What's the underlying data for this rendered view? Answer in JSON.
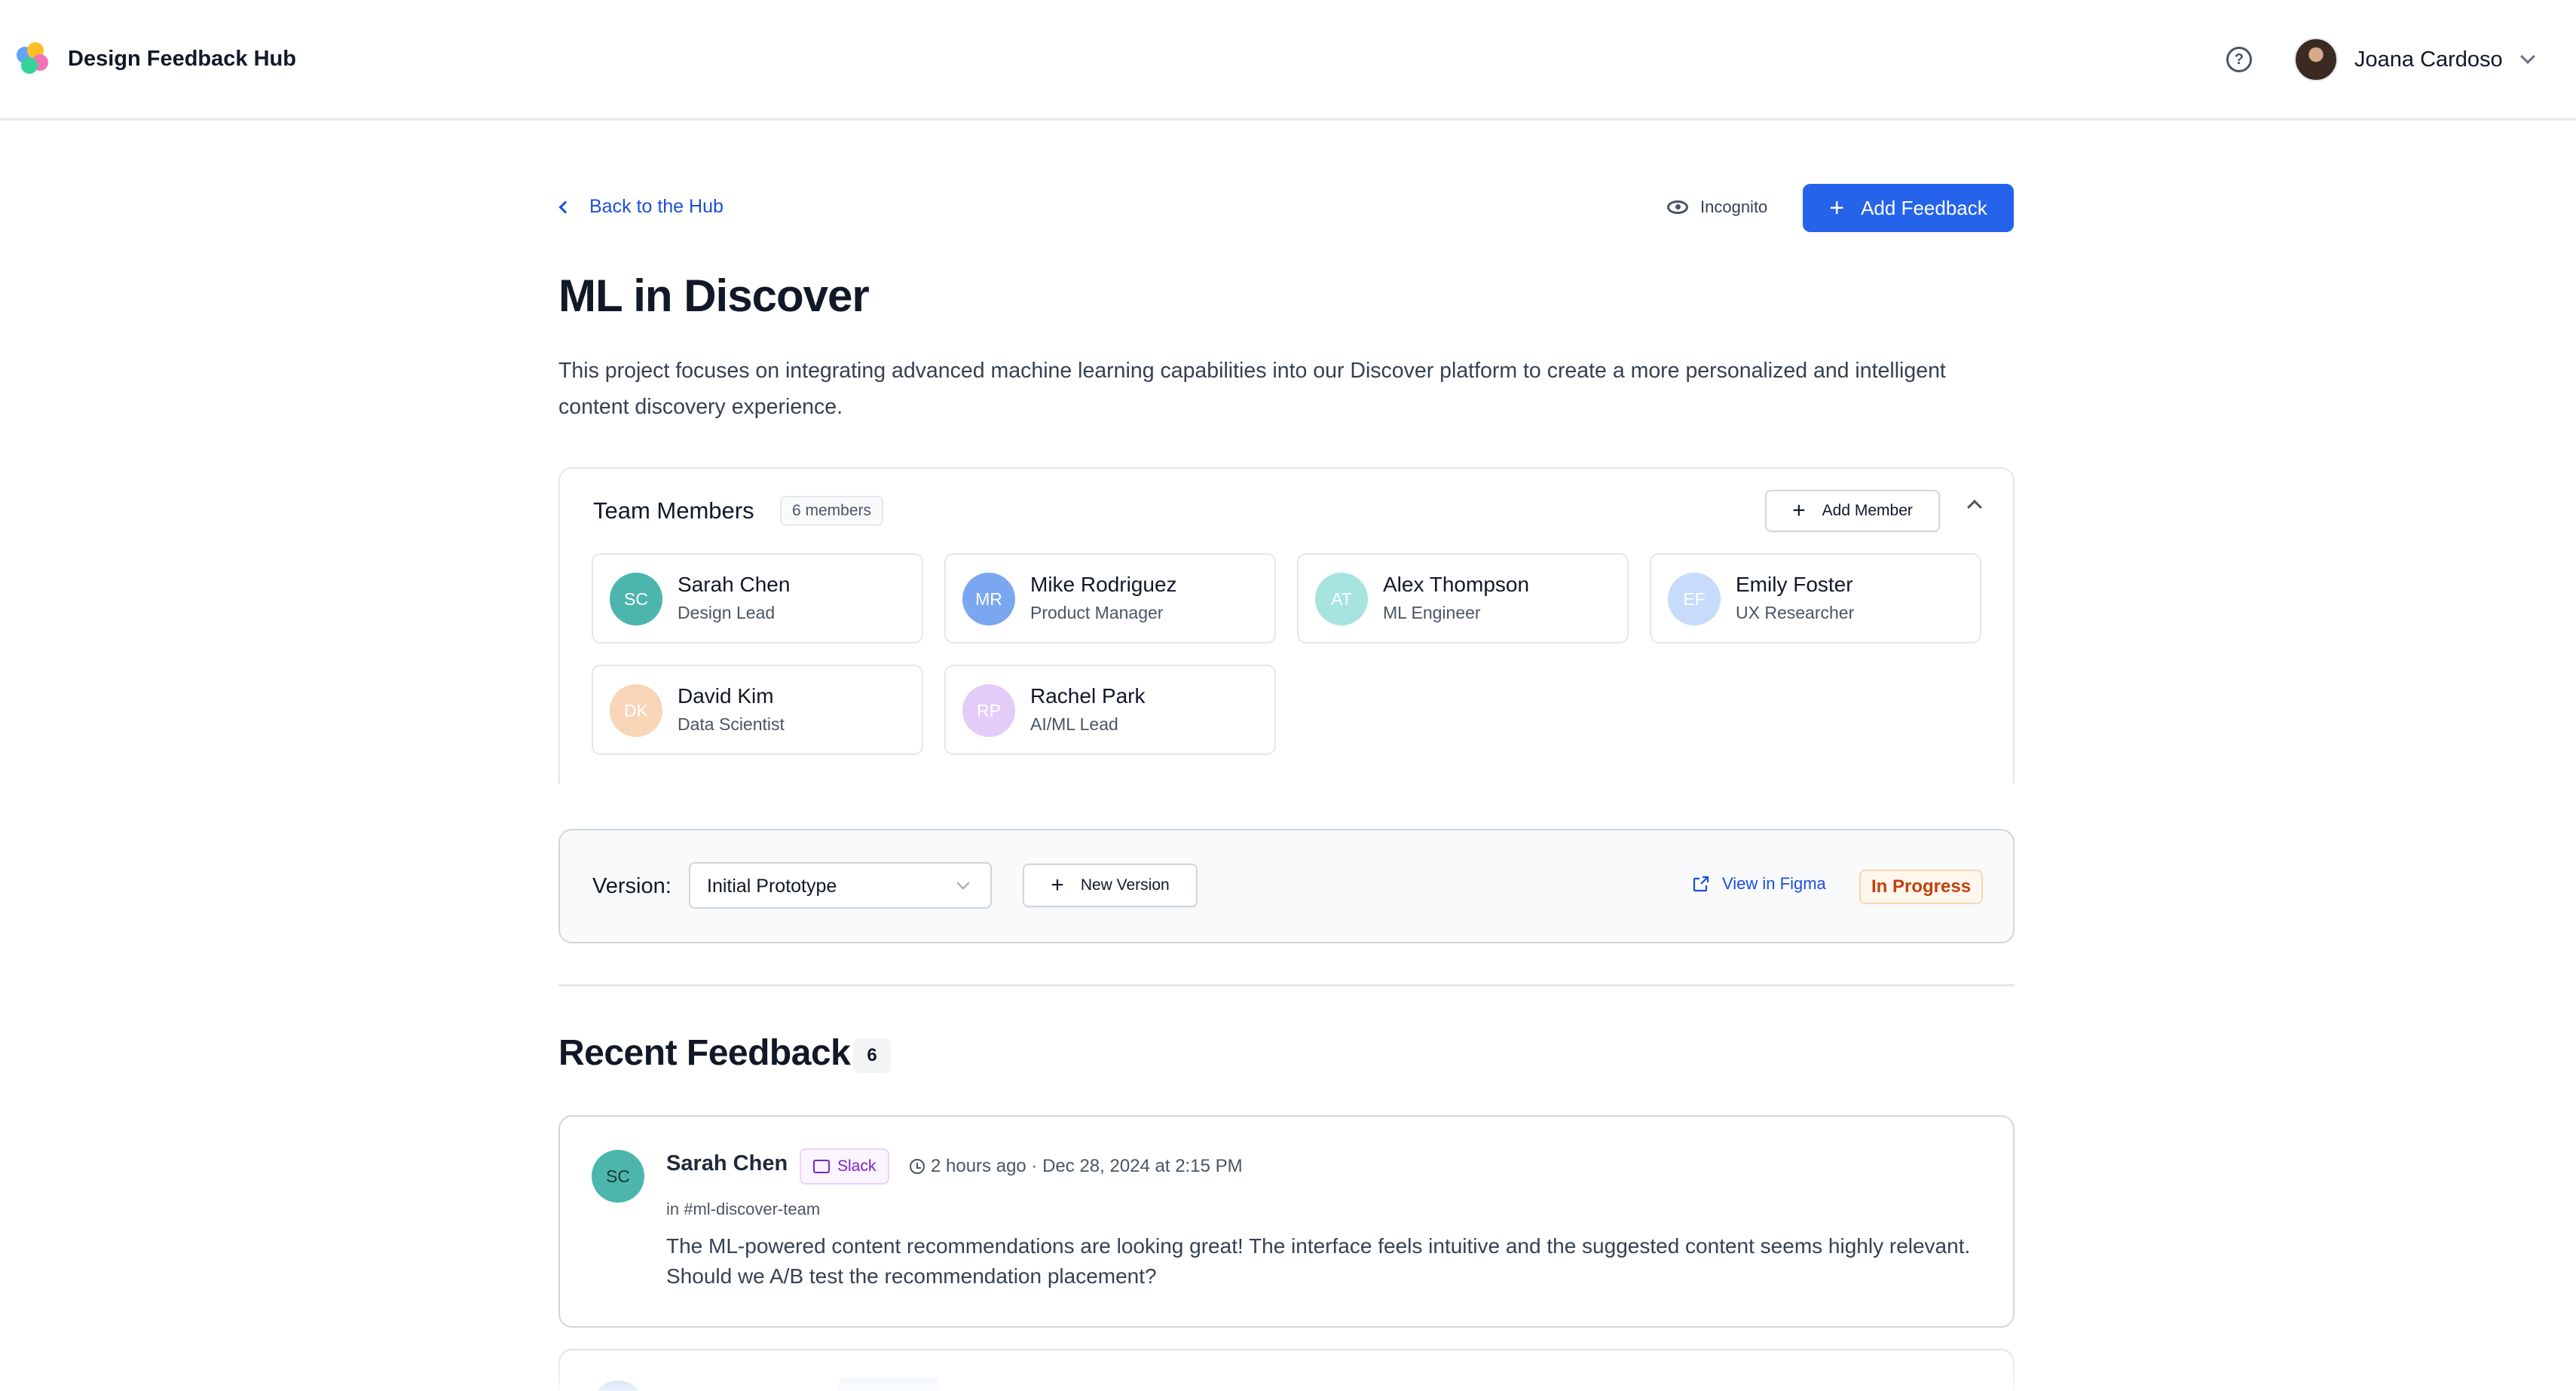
{
  "app": {
    "title": "Design Feedback Hub"
  },
  "header": {
    "user_name": "Joana Cardoso",
    "help_icon": "help-circle-icon"
  },
  "toolbar": {
    "back_label": "Back to the Hub",
    "incognito_label": "Incognito",
    "add_feedback_label": "Add Feedback"
  },
  "project": {
    "title": "ML in Discover",
    "description": "This project focuses on integrating advanced machine learning capabilities into our Discover platform to create a more personalized and intelligent content discovery experience."
  },
  "team": {
    "title": "Team Members",
    "count_label": "6 members",
    "add_member_label": "Add Member",
    "members": [
      {
        "initials": "SC",
        "name": "Sarah Chen",
        "role": "Design Lead",
        "color": "#4db6ac"
      },
      {
        "initials": "MR",
        "name": "Mike Rodriguez",
        "role": "Product Manager",
        "color": "#7aa7f0"
      },
      {
        "initials": "AT",
        "name": "Alex Thompson",
        "role": "ML Engineer",
        "color": "#a7e3df"
      },
      {
        "initials": "EF",
        "name": "Emily Foster",
        "role": "UX Researcher",
        "color": "#c7dbfb"
      },
      {
        "initials": "DK",
        "name": "David Kim",
        "role": "Data Scientist",
        "color": "#f8d5b7"
      },
      {
        "initials": "RP",
        "name": "Rachel Park",
        "role": "AI/ML Lead",
        "color": "#e3ccf8"
      }
    ]
  },
  "version": {
    "label": "Version:",
    "selected": "Initial Prototype",
    "new_version_label": "New Version",
    "figma_label": "View in Figma",
    "status": "In Progress"
  },
  "feedback": {
    "title": "Recent Feedback",
    "count": "6",
    "items": [
      {
        "initials": "SC",
        "author": "Sarah Chen",
        "source": "Slack",
        "time": "2 hours ago · Dec 28, 2024 at 2:15 PM",
        "channel": "in #ml-discover-team",
        "text": "The ML-powered content recommendations are looking great! The interface feels intuitive and the suggested content seems highly relevant. Should we A/B test the recommendation placement?"
      }
    ]
  },
  "colors": {
    "primary": "#2563eb",
    "status_in_progress": "#c2410c",
    "slack_purple": "#7e22ce"
  }
}
